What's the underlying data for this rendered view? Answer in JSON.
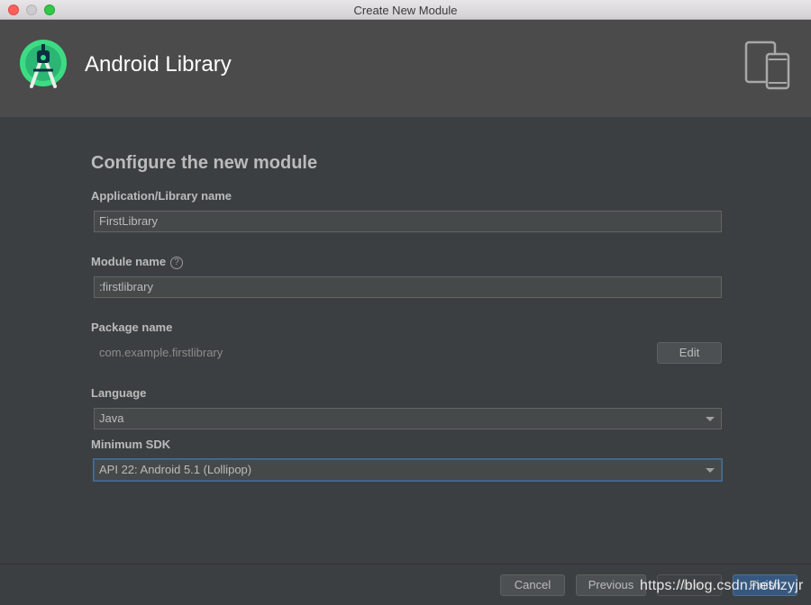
{
  "window": {
    "title": "Create New Module"
  },
  "header": {
    "module_type": "Android Library",
    "logo_icon": "android-studio-logo-icon",
    "device_icon": "tablet-phone-icon"
  },
  "form": {
    "heading": "Configure the new module",
    "app_name": {
      "label": "Application/Library name",
      "value": "FirstLibrary"
    },
    "module_name": {
      "label": "Module name",
      "help": "?",
      "value": ":firstlibrary"
    },
    "package_name": {
      "label": "Package name",
      "value": "com.example.firstlibrary",
      "edit_label": "Edit"
    },
    "language": {
      "label": "Language",
      "selected": "Java"
    },
    "min_sdk": {
      "label": "Minimum SDK",
      "selected": "API 22: Android 5.1 (Lollipop)"
    }
  },
  "footer": {
    "cancel_label": "Cancel",
    "previous_label": "Previous",
    "next_label": "Next",
    "finish_label": "Finish"
  },
  "watermark": "https://blog.csdn.net/lzyjr",
  "colors": {
    "accent": "#3d6185",
    "android_green": "#3ddc84"
  }
}
